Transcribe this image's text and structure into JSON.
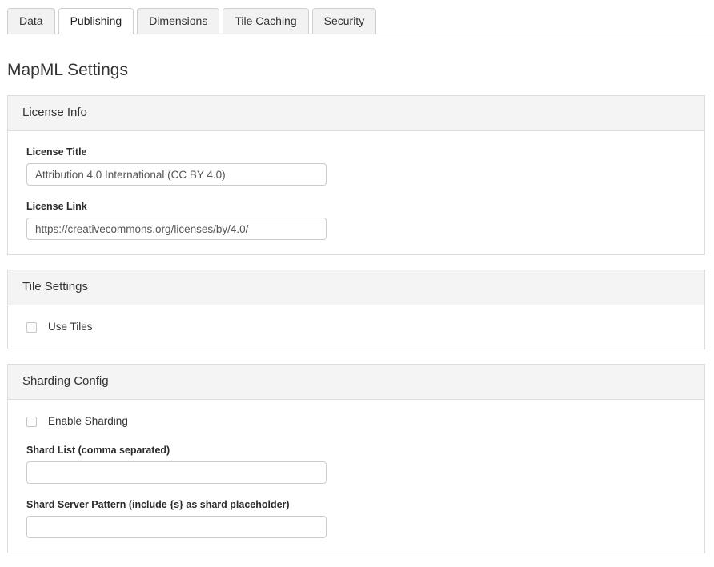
{
  "tabs": [
    {
      "label": "Data",
      "active": false
    },
    {
      "label": "Publishing",
      "active": true
    },
    {
      "label": "Dimensions",
      "active": false
    },
    {
      "label": "Tile Caching",
      "active": false
    },
    {
      "label": "Security",
      "active": false
    }
  ],
  "page": {
    "title": "MapML Settings"
  },
  "panels": {
    "license": {
      "header": "License Info",
      "title_label": "License Title",
      "title_value": "Attribution 4.0 International (CC BY 4.0)",
      "title_placeholder": "",
      "link_label": "License Link",
      "link_value": "https://creativecommons.org/licenses/by/4.0/",
      "link_placeholder": ""
    },
    "tiles": {
      "header": "Tile Settings",
      "use_tiles_label": "Use Tiles",
      "use_tiles_checked": false
    },
    "sharding": {
      "header": "Sharding Config",
      "enable_label": "Enable Sharding",
      "enable_checked": false,
      "shard_list_label": "Shard List (comma separated)",
      "shard_list_value": "",
      "shard_list_placeholder": "",
      "shard_pattern_label": "Shard Server Pattern (include {s} as shard placeholder)",
      "shard_pattern_value": "",
      "shard_pattern_placeholder": ""
    }
  },
  "colors": {
    "panel_header_bg": "#f4f4f4",
    "panel_border": "#dddddd",
    "tab_bg": "#f2f2f2",
    "tab_active_bg": "#ffffff",
    "input_border": "#cccccc",
    "text": "#333333"
  }
}
